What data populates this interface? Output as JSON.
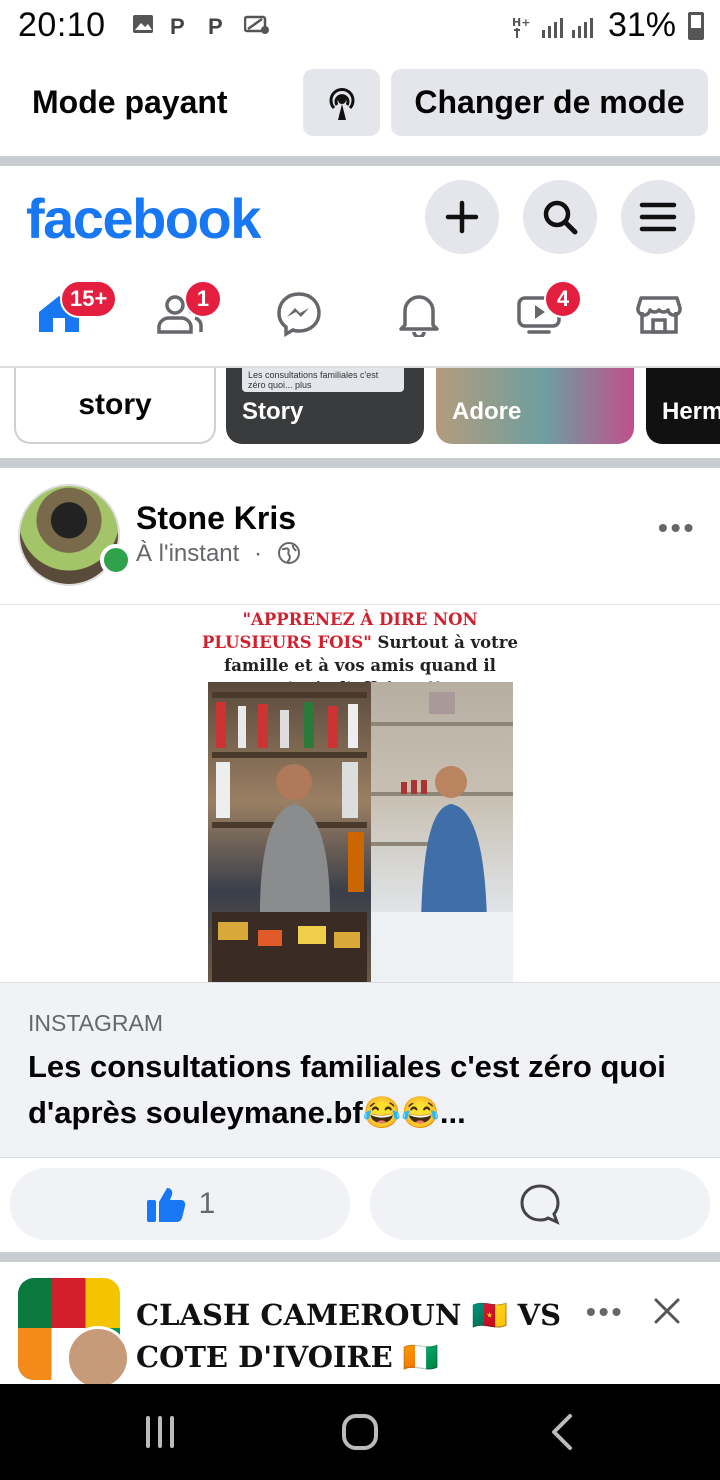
{
  "status_bar": {
    "time": "20:10",
    "icons": [
      "image-icon",
      "p-icon",
      "p-icon",
      "data-saver-icon"
    ],
    "network": "H+",
    "battery": "31%"
  },
  "mode_bar": {
    "label": "Mode payant",
    "change_button": "Changer de mode"
  },
  "header": {
    "logo": "facebook"
  },
  "nav": {
    "home_badge": "15+",
    "friends_badge": "1",
    "video_badge": "4"
  },
  "stories": {
    "add_label": "story",
    "items": [
      {
        "name": "Story",
        "preview": "Les consultations familiales c'est zéro quoi... plus"
      },
      {
        "name": "Adore"
      },
      {
        "name": "Herm"
      }
    ]
  },
  "post": {
    "author": "Stone Kris",
    "time": "À l'instant",
    "meme_text_red": "\"APPRENEZ À DIRE NON PLUSIEURS FOIS\"",
    "meme_text_black": "Surtout à votre famille et à vos amis quand il s'agit d'affaires !!",
    "link_source": "INSTAGRAM",
    "link_title": "Les consultations familiales c'est zéro quoi d'après souleymane.bf😂😂...",
    "like_count": "1"
  },
  "next_post": {
    "title": "CLASH CAMEROUN 🇨🇲 VS COTE D'IVOIRE 🇨🇮"
  }
}
